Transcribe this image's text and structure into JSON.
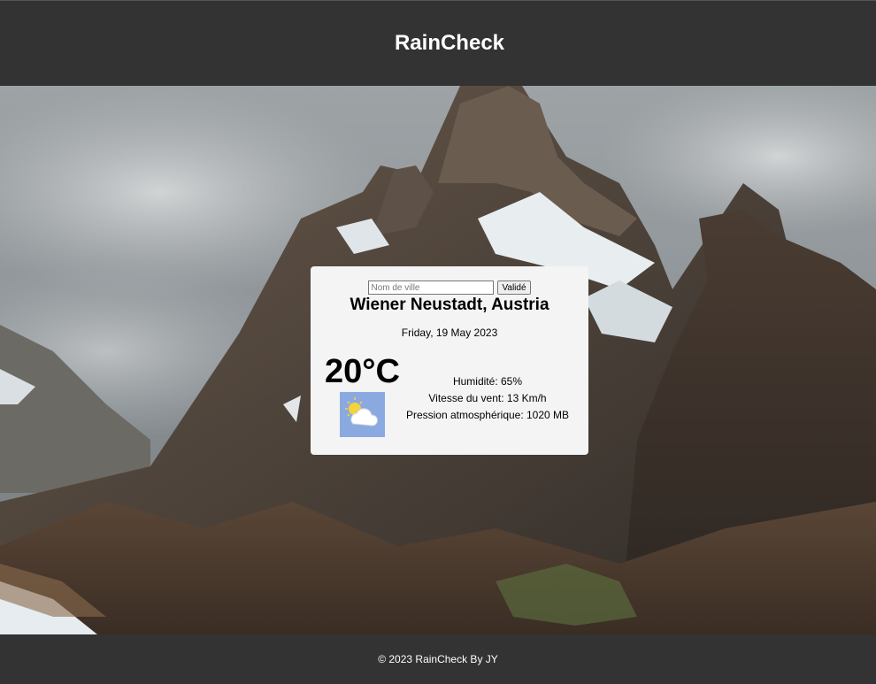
{
  "app": {
    "title": "RainCheck"
  },
  "search": {
    "placeholder": "Nom de ville",
    "value": "",
    "button_label": "Validé"
  },
  "weather": {
    "location": "Wiener Neustadt, Austria",
    "date": "Friday, 19 May 2023",
    "temperature": "20°C",
    "icon": "partly-cloudy-icon",
    "humidity": "Humidité: 65%",
    "wind": "Vitesse du vent: 13 Km/h",
    "pressure": "Pression atmosphérique: 1020 MB"
  },
  "footer": {
    "text": "© 2023 RainCheck By JY"
  },
  "colors": {
    "header_bg": "#333333",
    "card_bg": "#f4f4f4",
    "icon_bg": "#8aa9e0"
  }
}
